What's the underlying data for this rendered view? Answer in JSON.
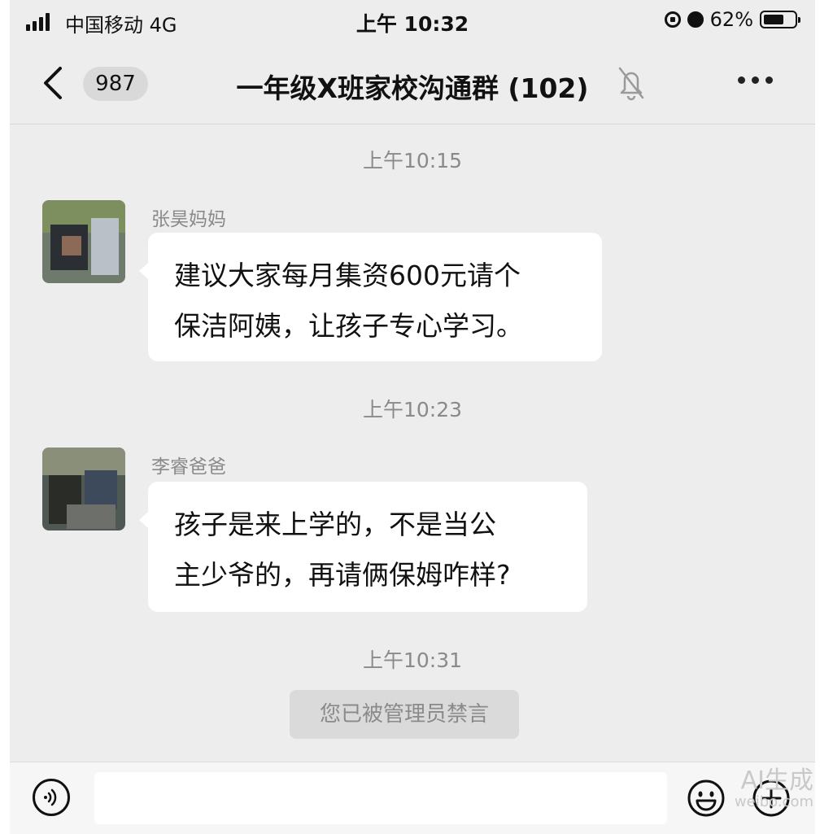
{
  "status_bar": {
    "carrier": "中国移动  4G",
    "time": "上午 10:32",
    "battery": "62%",
    "battery_level": 0.62,
    "icons": [
      "signal-icon",
      "rotation-lock-icon",
      "alarm-icon",
      "battery-icon"
    ]
  },
  "nav": {
    "back_icon": "chevron-left-icon",
    "unread_count": "987",
    "title": "一年级X班家校沟通群 (102)",
    "mute_icon": "bell-muted-icon",
    "more_icon": "more-dots-icon"
  },
  "messages": [
    {
      "type": "time",
      "text": "上午10:15"
    },
    {
      "type": "text",
      "sender": "张昊妈妈",
      "lines": [
        "建议大家每月集资600元请个",
        "保洁阿姨，让孩子专心学习。"
      ]
    },
    {
      "type": "time",
      "text": "上午10:23"
    },
    {
      "type": "text",
      "sender": "李睿爸爸",
      "lines": [
        "孩子是来上学的，不是当公",
        "主少爷的，再请俩保姆咋样?"
      ]
    },
    {
      "type": "time",
      "text": "上午10:31"
    },
    {
      "type": "system",
      "text": "您已被管理员禁言"
    }
  ],
  "input_bar": {
    "voice_icon": "voice-icon",
    "placeholder": "",
    "emoji_icon": "emoji-icon",
    "add_icon": "plus-circle-icon"
  },
  "watermark": {
    "text": "AI生成",
    "sub": "weibo.com"
  },
  "colors": {
    "background": "#ededed",
    "bubble": "#ffffff",
    "timestamp": "#8a8a8a",
    "system_note": "#dadada"
  }
}
